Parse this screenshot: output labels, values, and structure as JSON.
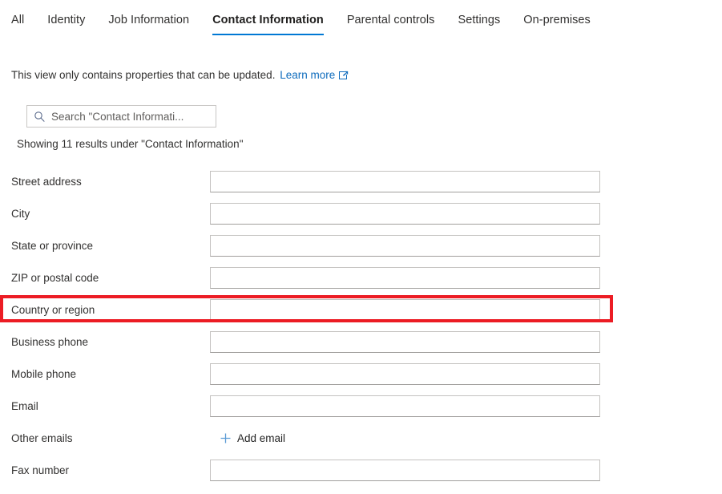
{
  "tabs": [
    {
      "label": "All",
      "active": false
    },
    {
      "label": "Identity",
      "active": false
    },
    {
      "label": "Job Information",
      "active": false
    },
    {
      "label": "Contact Information",
      "active": true
    },
    {
      "label": "Parental controls",
      "active": false
    },
    {
      "label": "Settings",
      "active": false
    },
    {
      "label": "On-premises",
      "active": false
    }
  ],
  "info": {
    "text": "This view only contains properties that can be updated.",
    "link_label": "Learn more",
    "link_icon": "external-link-icon"
  },
  "search": {
    "icon": "search-icon",
    "placeholder": "Search \"Contact Informati...",
    "value": ""
  },
  "results": {
    "text": "Showing 11 results under \"Contact Information\""
  },
  "fields": [
    {
      "label": "Street address",
      "value": "",
      "control": "input",
      "highlighted": false
    },
    {
      "label": "City",
      "value": "",
      "control": "input",
      "highlighted": false
    },
    {
      "label": "State or province",
      "value": "",
      "control": "input",
      "highlighted": false
    },
    {
      "label": "ZIP or postal code",
      "value": "",
      "control": "input",
      "highlighted": false
    },
    {
      "label": "Country or region",
      "value": "",
      "control": "input",
      "highlighted": true
    },
    {
      "label": "Business phone",
      "value": "",
      "control": "input",
      "highlighted": false
    },
    {
      "label": "Mobile phone",
      "value": "",
      "control": "input",
      "highlighted": false
    },
    {
      "label": "Email",
      "value": "",
      "control": "input",
      "highlighted": false
    },
    {
      "label": "Other emails",
      "value": "",
      "control": "addlink",
      "add_label": "Add email",
      "add_icon": "plus-icon",
      "highlighted": false
    },
    {
      "label": "Fax number",
      "value": "",
      "control": "input",
      "highlighted": false
    }
  ],
  "colors": {
    "accent": "#0078d4",
    "link": "#0f6cbd",
    "highlight": "#ec1c24",
    "text": "#323130",
    "border": "#c8c6c4"
  }
}
